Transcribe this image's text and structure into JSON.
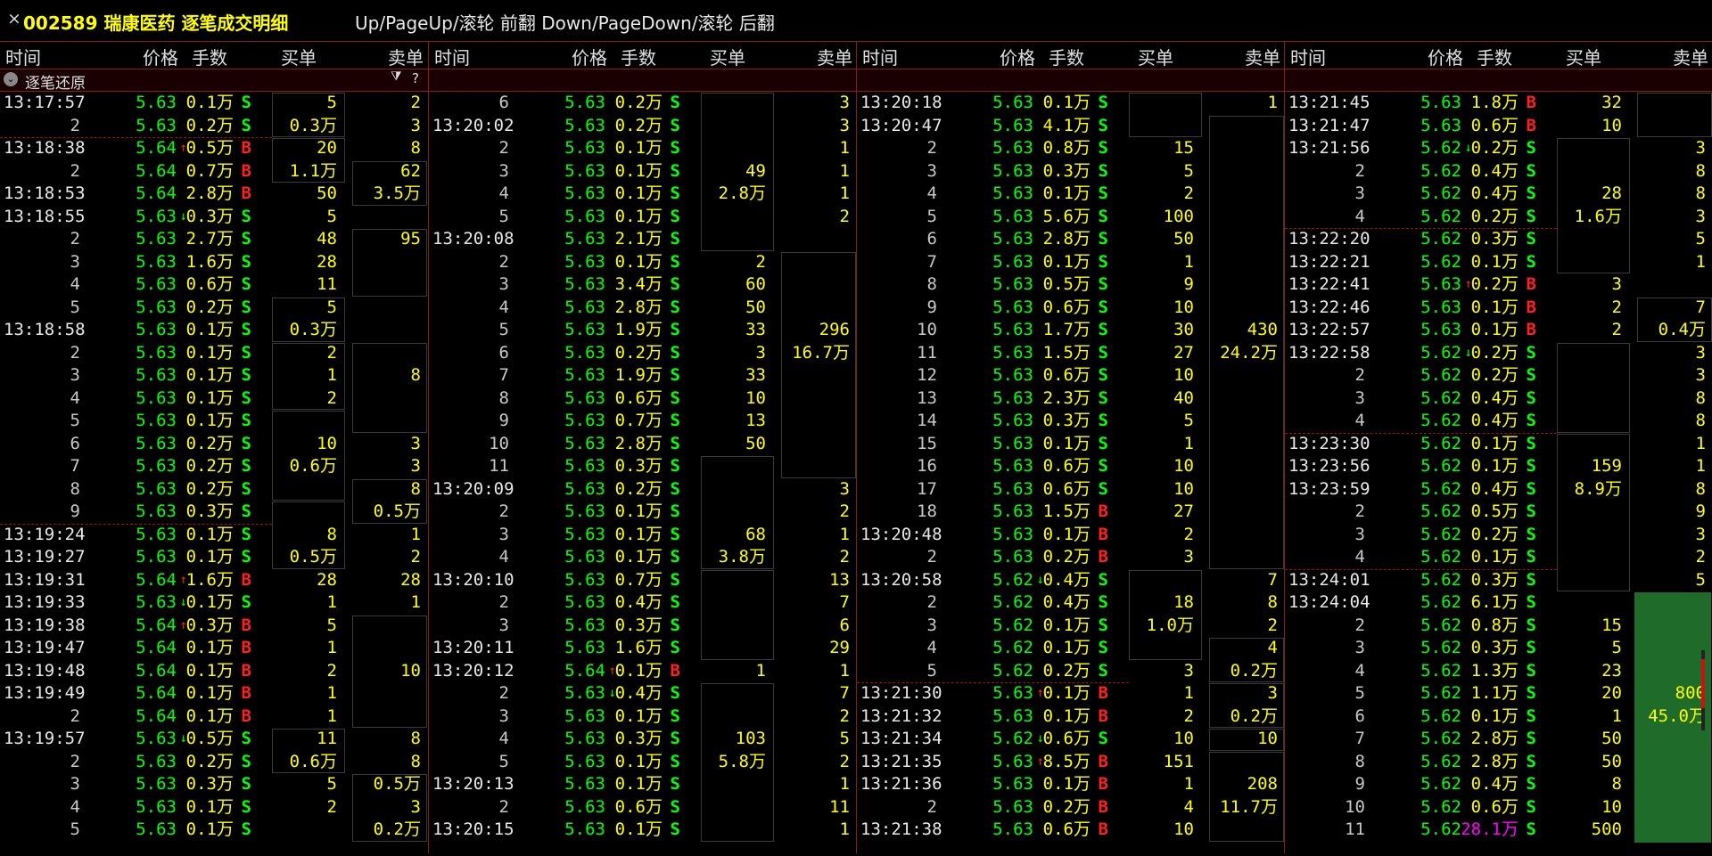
{
  "title": {
    "close": "×",
    "code": "002589",
    "name": "瑞康医药",
    "view": "逐笔成交明细",
    "hint": "Up/PageUp/滚轮 前翻 Down/PageDown/滚轮 后翻"
  },
  "headers": {
    "time": "时间",
    "price": "价格",
    "volume": "手数",
    "buy": "买单",
    "sell": "卖单"
  },
  "toolbar": {
    "label": "逐笔还原",
    "filter_icon": "funnel-icon",
    "help": "?"
  },
  "colors": {
    "rise": "#ff2020",
    "fall": "#00ff00",
    "order": "#ffff00",
    "big": "#ff00ff",
    "divider": "#8b1a1a"
  },
  "columns": [
    {
      "rows": [
        [
          "13:17:57",
          "5.63",
          "",
          "0.1万",
          "S",
          "5",
          "2"
        ],
        [
          "2",
          "5.63",
          "",
          "0.2万",
          "S",
          "0.3万",
          "3"
        ],
        [
          "13:18:38",
          "5.64",
          "up",
          "0.5万",
          "B",
          "20",
          "8"
        ],
        [
          "2",
          "5.64",
          "",
          "0.7万",
          "B",
          "1.1万",
          "62"
        ],
        [
          "13:18:53",
          "5.64",
          "",
          "2.8万",
          "B",
          "50",
          "3.5万"
        ],
        [
          "13:18:55",
          "5.63",
          "down",
          "0.3万",
          "S",
          "5",
          ""
        ],
        [
          "2",
          "5.63",
          "",
          "2.7万",
          "S",
          "48",
          "95"
        ],
        [
          "3",
          "5.63",
          "",
          "1.6万",
          "S",
          "28",
          ""
        ],
        [
          "4",
          "5.63",
          "",
          "0.6万",
          "S",
          "11",
          ""
        ],
        [
          "5",
          "5.63",
          "",
          "0.2万",
          "S",
          "5",
          ""
        ],
        [
          "13:18:58",
          "5.63",
          "",
          "0.1万",
          "S",
          "0.3万",
          ""
        ],
        [
          "2",
          "5.63",
          "",
          "0.1万",
          "S",
          "2",
          ""
        ],
        [
          "3",
          "5.63",
          "",
          "0.1万",
          "S",
          "1",
          "8"
        ],
        [
          "4",
          "5.63",
          "",
          "0.1万",
          "S",
          "2",
          ""
        ],
        [
          "5",
          "5.63",
          "",
          "0.1万",
          "S",
          "",
          ""
        ],
        [
          "6",
          "5.63",
          "",
          "0.2万",
          "S",
          "10",
          "3"
        ],
        [
          "7",
          "5.63",
          "",
          "0.2万",
          "S",
          "0.6万",
          "3"
        ],
        [
          "8",
          "5.63",
          "",
          "0.2万",
          "S",
          "",
          "8"
        ],
        [
          "9",
          "5.63",
          "",
          "0.3万",
          "S",
          "",
          "0.5万"
        ],
        [
          "13:19:24",
          "5.63",
          "",
          "0.1万",
          "S",
          "8",
          "1"
        ],
        [
          "13:19:27",
          "5.63",
          "",
          "0.1万",
          "S",
          "0.5万",
          "2"
        ],
        [
          "13:19:31",
          "5.64",
          "up",
          "1.6万",
          "B",
          "28",
          "28"
        ],
        [
          "13:19:33",
          "5.63",
          "down",
          "0.1万",
          "S",
          "1",
          "1"
        ],
        [
          "13:19:38",
          "5.64",
          "up",
          "0.3万",
          "B",
          "5",
          ""
        ],
        [
          "13:19:47",
          "5.64",
          "",
          "0.1万",
          "B",
          "1",
          ""
        ],
        [
          "13:19:48",
          "5.64",
          "",
          "0.1万",
          "B",
          "2",
          "10"
        ],
        [
          "13:19:49",
          "5.64",
          "",
          "0.1万",
          "B",
          "1",
          ""
        ],
        [
          "2",
          "5.64",
          "",
          "0.1万",
          "B",
          "1",
          ""
        ],
        [
          "13:19:57",
          "5.63",
          "down",
          "0.5万",
          "S",
          "11",
          "8"
        ],
        [
          "2",
          "5.63",
          "",
          "0.2万",
          "S",
          "0.6万",
          "8"
        ],
        [
          "3",
          "5.63",
          "",
          "0.3万",
          "S",
          "5",
          "0.5万"
        ],
        [
          "4",
          "5.63",
          "",
          "0.1万",
          "S",
          "2",
          "3"
        ],
        [
          "5",
          "5.63",
          "",
          "0.1万",
          "S",
          "",
          "0.2万"
        ]
      ]
    },
    {
      "rows": [
        [
          "6",
          "5.63",
          "",
          "0.2万",
          "S",
          "",
          "3"
        ],
        [
          "13:20:02",
          "5.63",
          "",
          "0.2万",
          "S",
          "",
          "3"
        ],
        [
          "2",
          "5.63",
          "",
          "0.1万",
          "S",
          "",
          "1"
        ],
        [
          "3",
          "5.63",
          "",
          "0.1万",
          "S",
          "49",
          "1"
        ],
        [
          "4",
          "5.63",
          "",
          "0.1万",
          "S",
          "2.8万",
          "1"
        ],
        [
          "5",
          "5.63",
          "",
          "0.1万",
          "S",
          "",
          "2"
        ],
        [
          "13:20:08",
          "5.63",
          "",
          "2.1万",
          "S",
          "",
          ""
        ],
        [
          "2",
          "5.63",
          "",
          "0.1万",
          "S",
          "2",
          ""
        ],
        [
          "3",
          "5.63",
          "",
          "3.4万",
          "S",
          "60",
          ""
        ],
        [
          "4",
          "5.63",
          "",
          "2.8万",
          "S",
          "50",
          ""
        ],
        [
          "5",
          "5.63",
          "",
          "1.9万",
          "S",
          "33",
          "296"
        ],
        [
          "6",
          "5.63",
          "",
          "0.2万",
          "S",
          "3",
          "16.7万"
        ],
        [
          "7",
          "5.63",
          "",
          "1.9万",
          "S",
          "33",
          ""
        ],
        [
          "8",
          "5.63",
          "",
          "0.6万",
          "S",
          "10",
          ""
        ],
        [
          "9",
          "5.63",
          "",
          "0.7万",
          "S",
          "13",
          ""
        ],
        [
          "10",
          "5.63",
          "",
          "2.8万",
          "S",
          "50",
          ""
        ],
        [
          "11",
          "5.63",
          "",
          "0.3万",
          "S",
          "",
          ""
        ],
        [
          "13:20:09",
          "5.63",
          "",
          "0.2万",
          "S",
          "",
          "3"
        ],
        [
          "2",
          "5.63",
          "",
          "0.1万",
          "S",
          "",
          "2"
        ],
        [
          "3",
          "5.63",
          "",
          "0.1万",
          "S",
          "68",
          "1"
        ],
        [
          "4",
          "5.63",
          "",
          "0.1万",
          "S",
          "3.8万",
          "2"
        ],
        [
          "13:20:10",
          "5.63",
          "",
          "0.7万",
          "S",
          "",
          "13"
        ],
        [
          "2",
          "5.63",
          "",
          "0.4万",
          "S",
          "",
          "7"
        ],
        [
          "3",
          "5.63",
          "",
          "0.3万",
          "S",
          "",
          "6"
        ],
        [
          "13:20:11",
          "5.63",
          "",
          "1.6万",
          "S",
          "",
          "29"
        ],
        [
          "13:20:12",
          "5.64",
          "up",
          "0.1万",
          "B",
          "1",
          "1"
        ],
        [
          "2",
          "5.63",
          "down",
          "0.4万",
          "S",
          "",
          "7"
        ],
        [
          "3",
          "5.63",
          "",
          "0.1万",
          "S",
          "",
          "2"
        ],
        [
          "4",
          "5.63",
          "",
          "0.3万",
          "S",
          "103",
          "5"
        ],
        [
          "5",
          "5.63",
          "",
          "0.1万",
          "S",
          "5.8万",
          "2"
        ],
        [
          "13:20:13",
          "5.63",
          "",
          "0.1万",
          "S",
          "",
          "1"
        ],
        [
          "2",
          "5.63",
          "",
          "0.6万",
          "S",
          "",
          "11"
        ],
        [
          "13:20:15",
          "5.63",
          "",
          "0.1万",
          "S",
          "",
          "1"
        ]
      ]
    },
    {
      "rows": [
        [
          "13:20:18",
          "5.63",
          "",
          "0.1万",
          "S",
          "",
          "1"
        ],
        [
          "13:20:47",
          "5.63",
          "",
          "4.1万",
          "S",
          "",
          ""
        ],
        [
          "2",
          "5.63",
          "",
          "0.8万",
          "S",
          "15",
          ""
        ],
        [
          "3",
          "5.63",
          "",
          "0.3万",
          "S",
          "5",
          ""
        ],
        [
          "4",
          "5.63",
          "",
          "0.1万",
          "S",
          "2",
          ""
        ],
        [
          "5",
          "5.63",
          "",
          "5.6万",
          "S",
          "100",
          ""
        ],
        [
          "6",
          "5.63",
          "",
          "2.8万",
          "S",
          "50",
          ""
        ],
        [
          "7",
          "5.63",
          "",
          "0.1万",
          "S",
          "1",
          ""
        ],
        [
          "8",
          "5.63",
          "",
          "0.5万",
          "S",
          "9",
          ""
        ],
        [
          "9",
          "5.63",
          "",
          "0.6万",
          "S",
          "10",
          ""
        ],
        [
          "10",
          "5.63",
          "",
          "1.7万",
          "S",
          "30",
          "430"
        ],
        [
          "11",
          "5.63",
          "",
          "1.5万",
          "S",
          "27",
          "24.2万"
        ],
        [
          "12",
          "5.63",
          "",
          "0.6万",
          "S",
          "10",
          ""
        ],
        [
          "13",
          "5.63",
          "",
          "2.3万",
          "S",
          "40",
          ""
        ],
        [
          "14",
          "5.63",
          "",
          "0.3万",
          "S",
          "5",
          ""
        ],
        [
          "15",
          "5.63",
          "",
          "0.1万",
          "S",
          "1",
          ""
        ],
        [
          "16",
          "5.63",
          "",
          "0.6万",
          "S",
          "10",
          ""
        ],
        [
          "17",
          "5.63",
          "",
          "0.6万",
          "S",
          "10",
          ""
        ],
        [
          "18",
          "5.63",
          "",
          "1.5万",
          "B",
          "27",
          ""
        ],
        [
          "13:20:48",
          "5.63",
          "",
          "0.1万",
          "B",
          "2",
          ""
        ],
        [
          "2",
          "5.63",
          "",
          "0.2万",
          "B",
          "3",
          ""
        ],
        [
          "13:20:58",
          "5.62",
          "down",
          "0.4万",
          "S",
          "",
          "7"
        ],
        [
          "2",
          "5.62",
          "",
          "0.4万",
          "S",
          "18",
          "8"
        ],
        [
          "3",
          "5.62",
          "",
          "0.1万",
          "S",
          "1.0万",
          "2"
        ],
        [
          "4",
          "5.62",
          "",
          "0.1万",
          "S",
          "",
          "4"
        ],
        [
          "5",
          "5.62",
          "",
          "0.2万",
          "S",
          "3",
          "0.2万"
        ],
        [
          "13:21:30",
          "5.63",
          "up",
          "0.1万",
          "B",
          "1",
          "3"
        ],
        [
          "13:21:32",
          "5.63",
          "",
          "0.1万",
          "B",
          "2",
          "0.2万"
        ],
        [
          "13:21:34",
          "5.62",
          "down",
          "0.6万",
          "S",
          "10",
          "10"
        ],
        [
          "13:21:35",
          "5.63",
          "up",
          "8.5万",
          "B",
          "151",
          ""
        ],
        [
          "13:21:36",
          "5.63",
          "",
          "0.1万",
          "B",
          "1",
          "208"
        ],
        [
          "2",
          "5.63",
          "",
          "0.2万",
          "B",
          "4",
          "11.7万"
        ],
        [
          "13:21:38",
          "5.63",
          "",
          "0.6万",
          "B",
          "10",
          ""
        ]
      ]
    },
    {
      "rows": [
        [
          "13:21:45",
          "5.63",
          "",
          "1.8万",
          "B",
          "32",
          ""
        ],
        [
          "13:21:47",
          "5.63",
          "",
          "0.6万",
          "B",
          "10",
          ""
        ],
        [
          "13:21:56",
          "5.62",
          "down",
          "0.2万",
          "S",
          "",
          "3"
        ],
        [
          "2",
          "5.62",
          "",
          "0.4万",
          "S",
          "",
          "8"
        ],
        [
          "3",
          "5.62",
          "",
          "0.4万",
          "S",
          "28",
          "8"
        ],
        [
          "4",
          "5.62",
          "",
          "0.2万",
          "S",
          "1.6万",
          "3"
        ],
        [
          "13:22:20",
          "5.62",
          "",
          "0.3万",
          "S",
          "",
          "5"
        ],
        [
          "13:22:21",
          "5.62",
          "",
          "0.1万",
          "S",
          "",
          "1"
        ],
        [
          "13:22:41",
          "5.63",
          "up",
          "0.2万",
          "B",
          "3",
          ""
        ],
        [
          "13:22:46",
          "5.63",
          "",
          "0.1万",
          "B",
          "2",
          "7"
        ],
        [
          "13:22:57",
          "5.63",
          "",
          "0.1万",
          "B",
          "2",
          "0.4万"
        ],
        [
          "13:22:58",
          "5.62",
          "down",
          "0.2万",
          "S",
          "",
          "3"
        ],
        [
          "2",
          "5.62",
          "",
          "0.2万",
          "S",
          "",
          "3"
        ],
        [
          "3",
          "5.62",
          "",
          "0.4万",
          "S",
          "",
          "8"
        ],
        [
          "4",
          "5.62",
          "",
          "0.4万",
          "S",
          "",
          "8"
        ],
        [
          "13:23:30",
          "5.62",
          "",
          "0.1万",
          "S",
          "",
          "1"
        ],
        [
          "13:23:56",
          "5.62",
          "",
          "0.1万",
          "S",
          "159",
          "1"
        ],
        [
          "13:23:59",
          "5.62",
          "",
          "0.4万",
          "S",
          "8.9万",
          "8"
        ],
        [
          "2",
          "5.62",
          "",
          "0.5万",
          "S",
          "",
          "9"
        ],
        [
          "3",
          "5.62",
          "",
          "0.2万",
          "S",
          "",
          "3"
        ],
        [
          "4",
          "5.62",
          "",
          "0.1万",
          "S",
          "",
          "2"
        ],
        [
          "13:24:01",
          "5.62",
          "",
          "0.3万",
          "S",
          "",
          "5"
        ],
        [
          "13:24:04",
          "5.62",
          "",
          "6.1万",
          "S",
          "",
          ""
        ],
        [
          "2",
          "5.62",
          "",
          "0.8万",
          "S",
          "15",
          ""
        ],
        [
          "3",
          "5.62",
          "",
          "0.3万",
          "S",
          "5",
          ""
        ],
        [
          "4",
          "5.62",
          "",
          "1.3万",
          "S",
          "23",
          ""
        ],
        [
          "5",
          "5.62",
          "",
          "1.1万",
          "S",
          "20",
          "800"
        ],
        [
          "6",
          "5.62",
          "",
          "0.1万",
          "S",
          "1",
          "45.0万"
        ],
        [
          "7",
          "5.62",
          "",
          "2.8万",
          "S",
          "50",
          ""
        ],
        [
          "8",
          "5.62",
          "",
          "2.8万",
          "S",
          "50",
          ""
        ],
        [
          "9",
          "5.62",
          "",
          "0.4万",
          "S",
          "8",
          ""
        ],
        [
          "10",
          "5.62",
          "",
          "0.6万",
          "S",
          "10",
          ""
        ],
        [
          "11",
          "5.62",
          "",
          "28.1万",
          "S",
          "500",
          ""
        ]
      ]
    }
  ]
}
